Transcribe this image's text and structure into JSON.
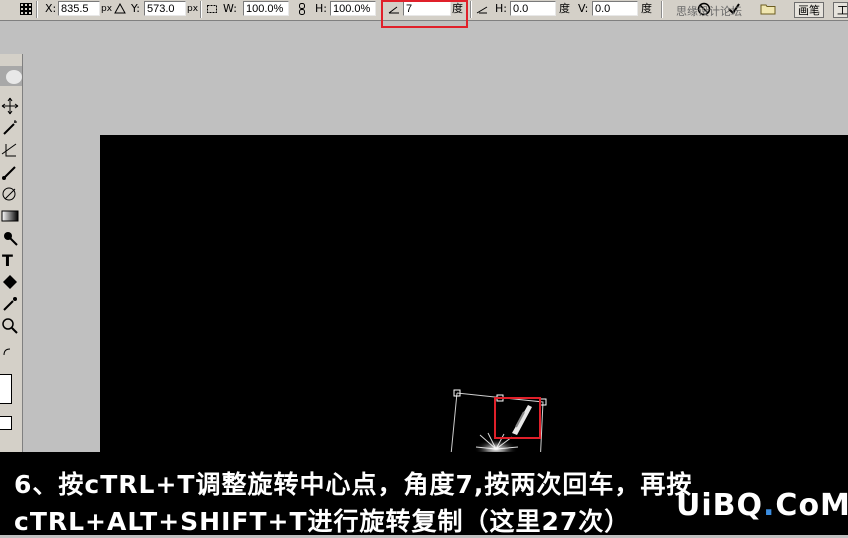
{
  "options_bar": {
    "x_label": "X:",
    "x_value": "835.5",
    "y_label": "Y:",
    "y_value": "573.0",
    "w_label": "W:",
    "w_value": "100.0%",
    "h_label": "H:",
    "h_value": "100.0%",
    "angle_value": "7",
    "angle_unit": "度",
    "skew_h_label": "H:",
    "skew_h_value": "0.0",
    "skew_h_unit": "度",
    "skew_v_label": "V:",
    "skew_v_value": "0.0",
    "skew_v_unit": "度",
    "tab_brush": "画笔",
    "tab_cut": "工"
  },
  "watermark_top": "思缘设计论坛",
  "caption": {
    "line1": "6、按cTRL+T调整旋转中心点，角度7,按两次回车，再按",
    "line2": "cTRL+ALT+SHIFT+T进行旋转复制（这里27次）"
  },
  "logo": {
    "part1": "UiBQ",
    "part2": ".",
    "part3": "CoM"
  },
  "colors": {
    "highlight": "#e0202a",
    "logo_accent": "#3b8de0"
  }
}
